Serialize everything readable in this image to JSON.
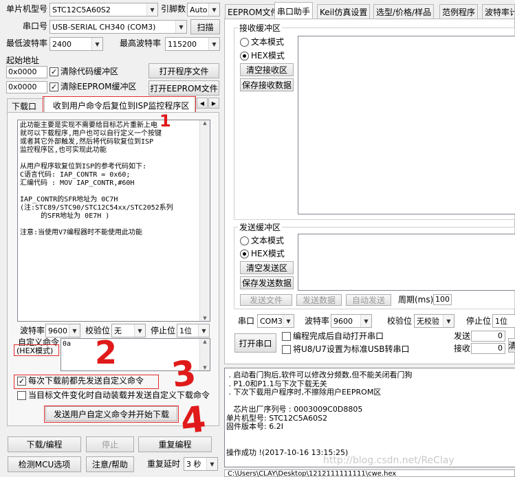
{
  "left": {
    "mcu_label": "单片机型号",
    "mcu_value": "STC12C5A60S2",
    "pin_label": "引脚数",
    "pin_value": "Auto",
    "port_label": "串口号",
    "port_value": "USB-SERIAL CH340 (COM3)",
    "scan_button": "扫描",
    "min_baud_label": "最低波特率",
    "min_baud_value": "2400",
    "max_baud_label": "最高波特率",
    "max_baud_value": "115200",
    "start_addr_label": "起始地址",
    "addr1": "0x0000",
    "clear_code_label": "清除代码缓冲区",
    "open_prog_button": "打开程序文件",
    "addr2": "0x0000",
    "clear_eeprom_label": "清除EEPROM缓冲区",
    "open_eeprom_button": "打开EEPROM文件",
    "tab_download": "下载口令",
    "tab_reset": "收到用户命令后复位到ISP监控程序区",
    "desc_text": "此功能主要是实现不需要给目标芯片重新上电\n就可以下载程序,用户也可以自行定义一个按键\n或者其它外部触发,然后将代码软复位到ISP\n监控程序区,也可实现此功能\n\n从用户程序软复位到ISP的参考代码如下:\nC语言代码: IAP_CONTR = 0x60;\n汇编代码 : MOV IAP_CONTR,#60H\n\nIAP_CONTR的SFR地址为 0C7H\n(注:STC89/STC90/STC12C54xx/STC2052系列\n     的SFR地址为 0E7H )\n\n注意:当使用V7编程器时不能使用此功能",
    "baud_label": "波特率",
    "baud_value": "9600",
    "parity_label": "校验位",
    "parity_value": "无",
    "stop_label": "停止位",
    "stop_value": "1位",
    "custom_cmd_label": "自定义命令",
    "hex_mode_label": "(HEX模式)",
    "custom_cmd_value": "0a",
    "send_before_label": "每次下载前都先发送自定义命令",
    "auto_load_label": "当目标文件变化时自动装载并发送自定义下载命令",
    "send_start_button": "发送用户自定义命令并开始下载",
    "download_button": "下载/编程",
    "stop_button": "停止",
    "reprogram_button": "重复编程",
    "detect_button": "检测MCU选项",
    "help_button": "注意/帮助",
    "delay_label": "重复延时",
    "delay_value": "3 秒"
  },
  "right": {
    "tabs": [
      "EEPROM文件",
      "串口助手",
      "Keil仿真设置",
      "选型/价格/样品",
      "范例程序",
      "波特率计"
    ],
    "recv_group": "接收缓冲区",
    "text_mode": "文本模式",
    "hex_mode": "HEX模式",
    "clear_recv": "清空接收区",
    "save_recv": "保存接收数据",
    "send_group": "发送缓冲区",
    "send_text_mode": "文本模式",
    "send_hex_mode": "HEX模式",
    "clear_send": "清空发送区",
    "save_send": "保存发送数据",
    "send_file": "发送文件",
    "send_data": "发送数据",
    "auto_send": "自动发送",
    "period_label": "周期(ms)",
    "period_value": "100",
    "port_label": "串口",
    "port_value": "COM3",
    "baud_label": "波特率",
    "baud_value": "9600",
    "parity_label": "校验位",
    "parity_value": "无校验",
    "stop_label": "停止位",
    "stop_value": "1位",
    "open_port": "打开串口",
    "auto_open_label": "编程完成后自动打开串口",
    "usb_label": "将U8/U7设置为标准USB转串口",
    "send_count_label": "发送",
    "send_count": "0",
    "recv_count_label": "接收",
    "recv_count": "0",
    "clear_counter": "清",
    "log_text": " . 启动看门狗后,软件可以修改分频数,但不能关闭看门狗\n . P1.0和P1.1与下次下载无关\n . 下次下载用户程序时,不擦除用户EEPROM区\n\n   芯片出厂序列号 : 0003009C0D8805\n单片机型号: STC12C5A60S2\n固件版本号: 6.2I\n\n\n操作成功 !(2017-10-16 13:15:25)",
    "path_text": "C:\\Users\\CLAY\\Desktop\\1212111111111\\cwe.hex",
    "watermark": "http://blog.csdn.net/ReClay"
  },
  "annotations": [
    "1",
    "2",
    "3",
    "4"
  ],
  "colors": {
    "highlight": "#e52b2b",
    "annotation": "#e01a1a"
  }
}
